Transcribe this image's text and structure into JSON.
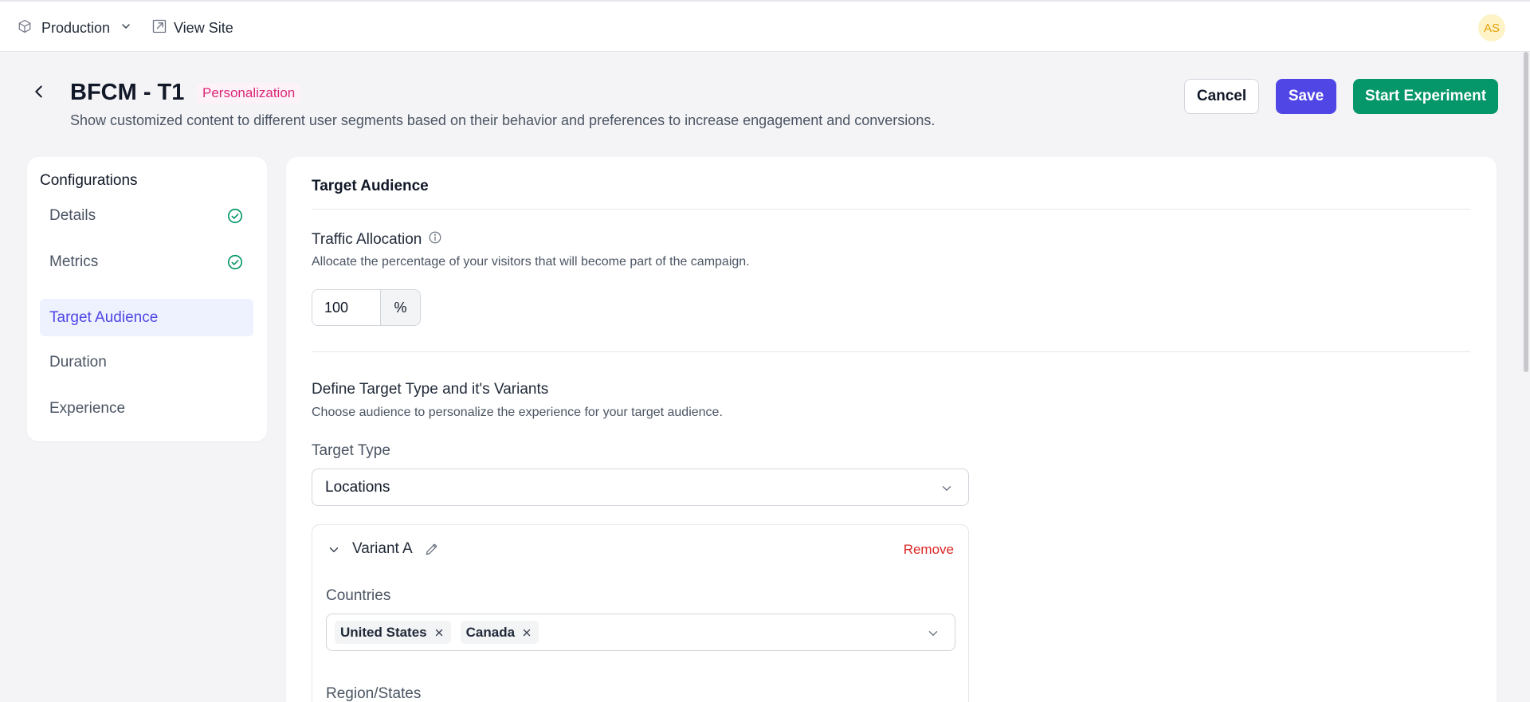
{
  "topbar": {
    "environment": "Production",
    "view_site": "View Site",
    "avatar_initials": "AS"
  },
  "header": {
    "title": "BFCM - T1",
    "badge": "Personalization",
    "description": "Show customized content to different user segments based on their behavior and preferences to increase engagement and conversions.",
    "cancel_label": "Cancel",
    "save_label": "Save",
    "start_label": "Start Experiment"
  },
  "sidebar": {
    "title": "Configurations",
    "items": [
      {
        "label": "Details",
        "completed": true
      },
      {
        "label": "Metrics",
        "completed": true
      },
      {
        "label": "Target Audience",
        "active": true
      },
      {
        "label": "Duration"
      },
      {
        "label": "Experience"
      }
    ]
  },
  "main": {
    "section_title": "Target Audience",
    "traffic": {
      "label": "Traffic Allocation",
      "help": "Allocate the percentage of your visitors that will become part of the campaign.",
      "value": "100",
      "unit": "%"
    },
    "target": {
      "heading": "Define Target Type and it's Variants",
      "help": "Choose audience to personalize the experience for your target audience.",
      "type_label": "Target Type",
      "type_value": "Locations"
    },
    "variant": {
      "name": "Variant A",
      "remove_label": "Remove",
      "countries_label": "Countries",
      "countries": [
        "United States",
        "Canada"
      ],
      "region_label": "Region/States"
    }
  },
  "colors": {
    "accent": "#4f46e5",
    "success": "#059669",
    "danger": "#dc2626",
    "badge": "#db2777"
  }
}
